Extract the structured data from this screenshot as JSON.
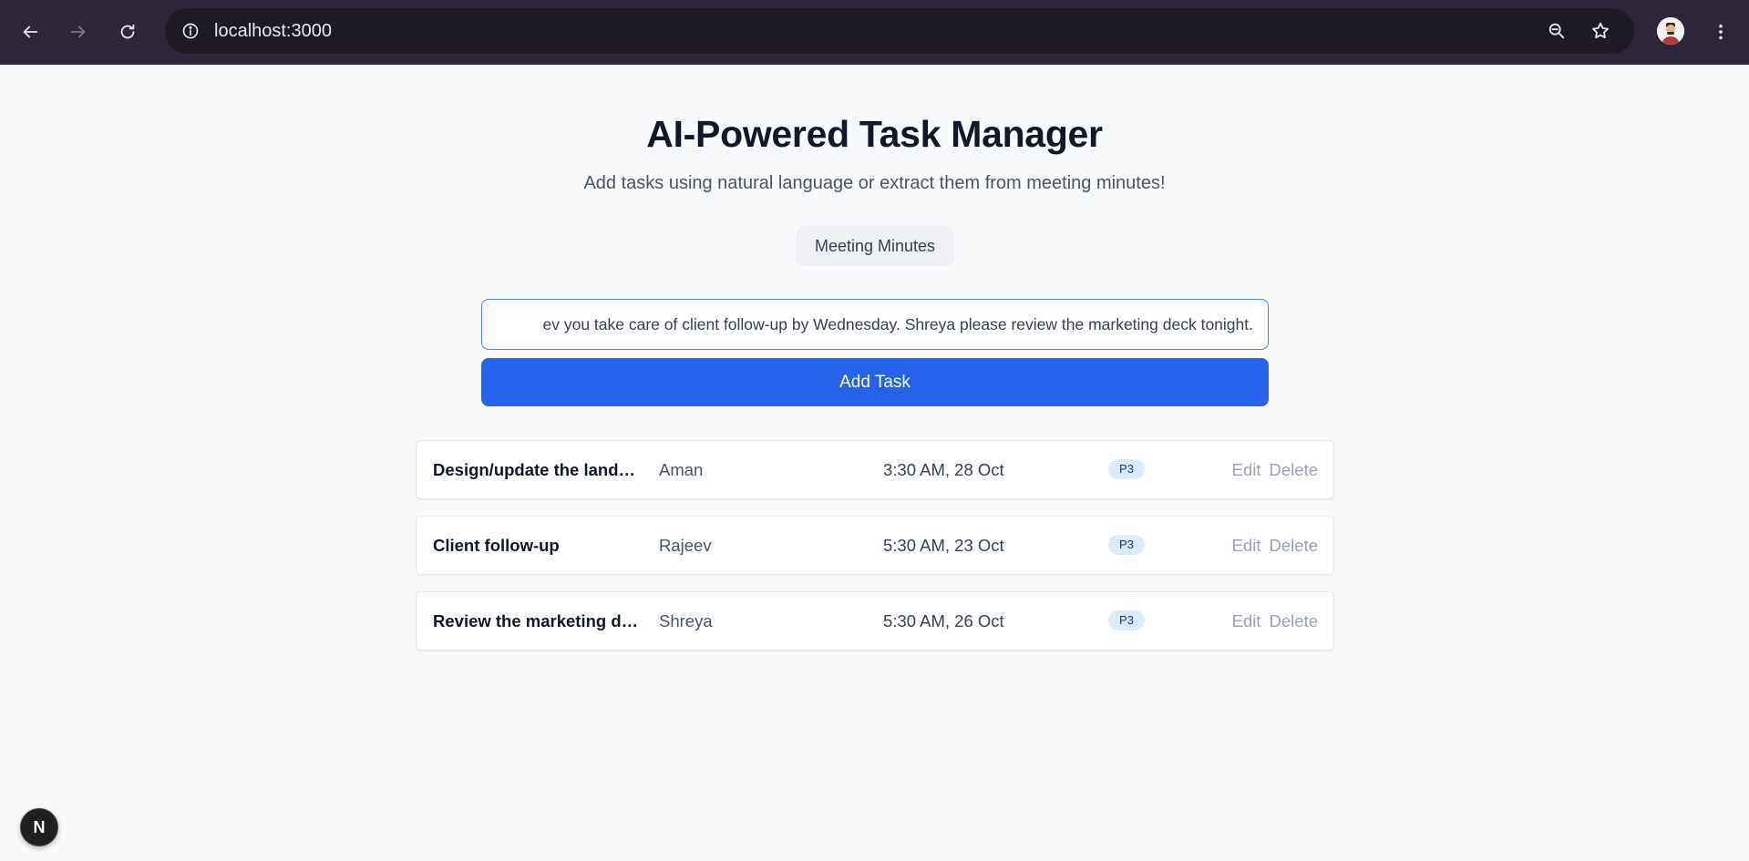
{
  "browser": {
    "url": "localhost:3000",
    "back_icon": "arrow-left",
    "forward_icon": "arrow-right",
    "reload_icon": "reload",
    "info_icon": "info-circle",
    "zoom_icon": "zoom-out",
    "bookmark_icon": "star",
    "menu_icon": "three-dots-vertical"
  },
  "header": {
    "title": "AI-Powered Task Manager",
    "subtitle": "Add tasks using natural language or extract them from meeting minutes!"
  },
  "mode_toggle": {
    "label": "Meeting Minutes"
  },
  "input": {
    "value": "ev you take care of client follow-up by Wednesday. Shreya please review the marketing deck tonight."
  },
  "add_button": {
    "label": "Add Task"
  },
  "tasks": [
    {
      "title": "Design/update the landin…",
      "assignee": "Aman",
      "due": "3:30 AM, 28 Oct",
      "priority": "P3",
      "edit": "Edit",
      "delete": "Delete"
    },
    {
      "title": "Client follow-up",
      "assignee": "Rajeev",
      "due": "5:30 AM, 23 Oct",
      "priority": "P3",
      "edit": "Edit",
      "delete": "Delete"
    },
    {
      "title": "Review the marketing de…",
      "assignee": "Shreya",
      "due": "5:30 AM, 26 Oct",
      "priority": "P3",
      "edit": "Edit",
      "delete": "Delete"
    }
  ],
  "dev_badge": {
    "label": "N"
  },
  "colors": {
    "primary": "#2563eb",
    "priority_bg": "#dbeafe",
    "priority_text": "#1e3a8a",
    "chrome_bg": "#2c2638"
  }
}
